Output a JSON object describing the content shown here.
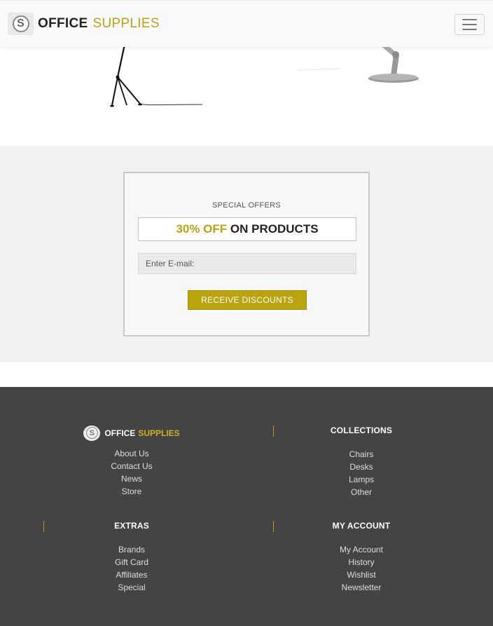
{
  "header": {
    "logo_letter": "S",
    "brand_word1": "OFFICE",
    "brand_word2": "SUPPLIES",
    "menu_icon": "hamburger-menu-icon"
  },
  "products": [
    {
      "image": "floor-lamp-image"
    },
    {
      "image": "desk-lamp-image"
    }
  ],
  "offer": {
    "label": "SPECIAL OFFERS",
    "percent": "30% OFF",
    "rest": "ON PRODUCTS",
    "email_placeholder": "Enter E-mail:",
    "button_label": "RECEIVE DISCOUNTS"
  },
  "footer": {
    "brand": {
      "logo_letter": "S",
      "word1": "OFFICE",
      "word2": "SUPPLIES"
    },
    "brand_links": [
      "About Us",
      "Contact Us",
      "News",
      "Store"
    ],
    "collections": {
      "heading": "COLLECTIONS",
      "links": [
        "Chairs",
        "Desks",
        "Lamps",
        "Other"
      ]
    },
    "extras": {
      "heading": "EXTRAS",
      "links": [
        "Brands",
        "Gift Card",
        "Affiliates",
        "Special"
      ]
    },
    "account": {
      "heading": "MY ACCOUNT",
      "links": [
        "My Account",
        "History",
        "Wishlist",
        "Newsletter"
      ]
    }
  },
  "colors": {
    "accent": "#b9a40e",
    "footer_bg": "#444444",
    "section_bg": "#f2f2f2"
  }
}
